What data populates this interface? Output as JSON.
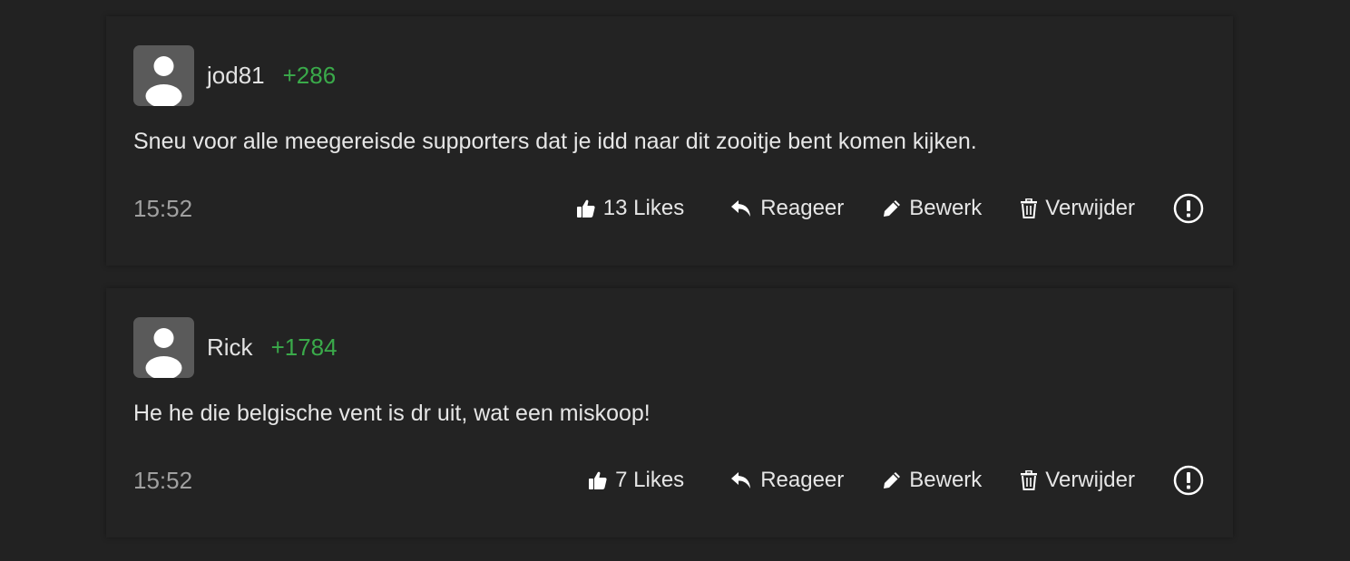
{
  "comments": [
    {
      "username": "jod81",
      "score": "+286",
      "text": "Sneu voor alle meegereisde supporters dat je idd naar dit zooitje bent komen kijken.",
      "time": "15:52",
      "likes_label": "13 Likes",
      "reply_label": "Reageer",
      "edit_label": "Bewerk",
      "delete_label": "Verwijder"
    },
    {
      "username": "Rick",
      "score": "+1784",
      "text": "He he die belgische vent is dr uit, wat een miskoop!",
      "time": "15:52",
      "likes_label": "7 Likes",
      "reply_label": "Reageer",
      "edit_label": "Bewerk",
      "delete_label": "Verwijder"
    }
  ],
  "colors": {
    "background": "#222222",
    "score": "#3aaa4a",
    "time": "#a0a0a0",
    "avatar": "#5a5a5a"
  },
  "icons": [
    "user-avatar-icon",
    "thumbs-up-icon",
    "reply-icon",
    "pencil-icon",
    "trash-icon",
    "report-icon"
  ]
}
